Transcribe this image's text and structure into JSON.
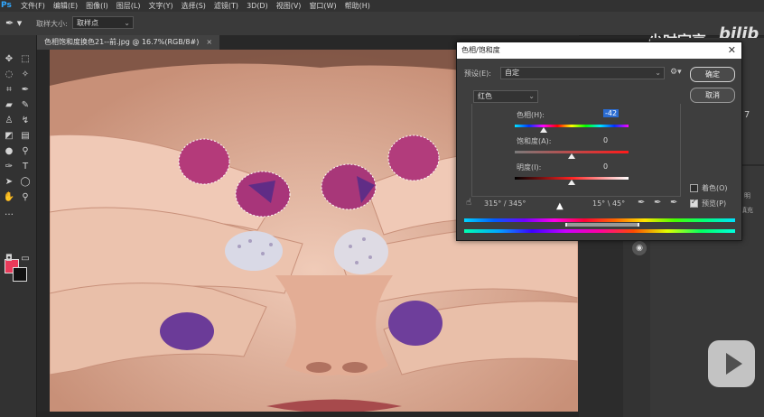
{
  "app": {
    "logo": "Ps",
    "menu": [
      "文件(F)",
      "编辑(E)",
      "图像(I)",
      "图层(L)",
      "文字(Y)",
      "选择(S)",
      "滤镜(T)",
      "3D(D)",
      "视图(V)",
      "窗口(W)",
      "帮助(H)"
    ]
  },
  "options": {
    "sample_size_label": "取样大小:",
    "sample_size_value": "取样点"
  },
  "watermark": {
    "text": "少时宗恴",
    "logo": "bilib"
  },
  "document": {
    "tab_title": "色相饱和度换色21--前.jpg @ 16.7%(RGB/8#)",
    "close": "×"
  },
  "dialog": {
    "title": "色相/饱和度",
    "close": "✕",
    "preset_label": "预设(E):",
    "preset_value": "自定",
    "channel_value": "红色",
    "ok": "确定",
    "cancel": "取消",
    "hue_label": "色相(H):",
    "hue_value": "-42",
    "saturation_label": "饱和度(A):",
    "saturation_value": "0",
    "lightness_label": "明度(I):",
    "lightness_value": "0",
    "range_left": "315° / 345°",
    "range_right": "15° \\ 45°",
    "colorize_label": "着色(O)",
    "preview_label": "预览(P)",
    "hue_fraction": 0.25,
    "saturation_fraction": 0.5,
    "lightness_fraction": 0.5
  },
  "right_panel": {
    "glyph1": "7",
    "text1": "明",
    "text2": "填充"
  },
  "colors": {
    "foreground": "#e93a5a",
    "background": "#111111",
    "accent": "#2a6bd1"
  }
}
